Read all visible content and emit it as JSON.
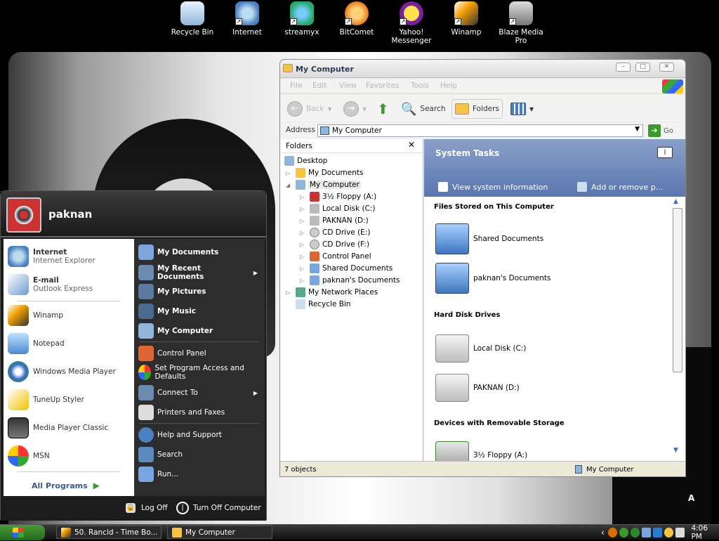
{
  "desktop": {
    "icons": [
      {
        "label": "Recycle Bin",
        "icon": "recycle-bin-icon"
      },
      {
        "label": "Internet",
        "icon": "internet-explorer-icon"
      },
      {
        "label": "streamyx",
        "icon": "streamyx-icon"
      },
      {
        "label": "BitComet",
        "icon": "bitcomet-icon"
      },
      {
        "label": "Yahoo! Messenger",
        "icon": "yahoo-messenger-icon"
      },
      {
        "label": "Winamp",
        "icon": "winamp-icon"
      },
      {
        "label": "Blaze Media Pro",
        "icon": "blaze-media-pro-icon"
      }
    ],
    "wallpaper_text": "A"
  },
  "window": {
    "title": "My Computer",
    "menus": [
      "File",
      "Edit",
      "View",
      "Favorites",
      "Tools",
      "Help"
    ],
    "toolbar": {
      "back": "Back",
      "search": "Search",
      "folders": "Folders"
    },
    "address_label": "Address",
    "address_value": "My Computer",
    "go_label": "Go",
    "folders_title": "Folders",
    "tree": [
      {
        "label": "Desktop",
        "level": 0
      },
      {
        "label": "My Documents",
        "level": 1
      },
      {
        "label": "My Computer",
        "level": 1
      },
      {
        "label": "3½ Floppy (A:)",
        "level": 2
      },
      {
        "label": "Local Disk (C:)",
        "level": 2
      },
      {
        "label": "PAKNAN (D:)",
        "level": 2
      },
      {
        "label": "CD Drive (E:)",
        "level": 2
      },
      {
        "label": "CD Drive (F:)",
        "level": 2
      },
      {
        "label": "Control Panel",
        "level": 2
      },
      {
        "label": "Shared Documents",
        "level": 2
      },
      {
        "label": "paknan's Documents",
        "level": 2
      },
      {
        "label": "My Network Places",
        "level": 1
      },
      {
        "label": "Recycle Bin",
        "level": 1
      }
    ],
    "system_tasks": {
      "title": "System Tasks",
      "tasks": [
        "View system information",
        "Add or remove p..."
      ]
    },
    "sections": {
      "files": "Files Stored on This Computer",
      "hdd": "Hard Disk Drives",
      "removable": "Devices with Removable Storage"
    },
    "items": {
      "shared": "Shared Documents",
      "paknan_docs": "paknan's Documents",
      "local_c": "Local Disk (C:)",
      "paknan_d": "PAKNAN (D:)",
      "floppy": "3½ Floppy (A:)"
    },
    "status": {
      "count": "7 objects",
      "location": "My Computer"
    }
  },
  "start_menu": {
    "user": "paknan",
    "left": [
      {
        "title": "Internet",
        "sub": "Internet Explorer"
      },
      {
        "title": "E-mail",
        "sub": "Outlook Express"
      },
      {
        "title": "Winamp",
        "sub": ""
      },
      {
        "title": "Notepad",
        "sub": ""
      },
      {
        "title": "Windows Media Player",
        "sub": ""
      },
      {
        "title": "TuneUp Styler",
        "sub": ""
      },
      {
        "title": "Media Player Classic",
        "sub": ""
      },
      {
        "title": "MSN",
        "sub": ""
      }
    ],
    "all_programs": "All Programs",
    "right": [
      {
        "label": "My Documents",
        "bold": true
      },
      {
        "label": "My Recent Documents",
        "bold": true
      },
      {
        "label": "My Pictures",
        "bold": true
      },
      {
        "label": "My Music",
        "bold": true
      },
      {
        "label": "My Computer",
        "bold": true
      },
      {
        "label": "Control Panel",
        "bold": false
      },
      {
        "label": "Set Program Access and Defaults",
        "bold": false
      },
      {
        "label": "Connect To",
        "bold": false
      },
      {
        "label": "Printers and Faxes",
        "bold": false
      },
      {
        "label": "Help and Support",
        "bold": false
      },
      {
        "label": "Search",
        "bold": false
      },
      {
        "label": "Run...",
        "bold": false
      }
    ],
    "logoff": "Log Off",
    "turnoff": "Turn Off Computer"
  },
  "taskbar": {
    "buttons": [
      "50. Rancid - Time Bo...",
      "My Computer"
    ],
    "clock": "4:06 PM"
  }
}
